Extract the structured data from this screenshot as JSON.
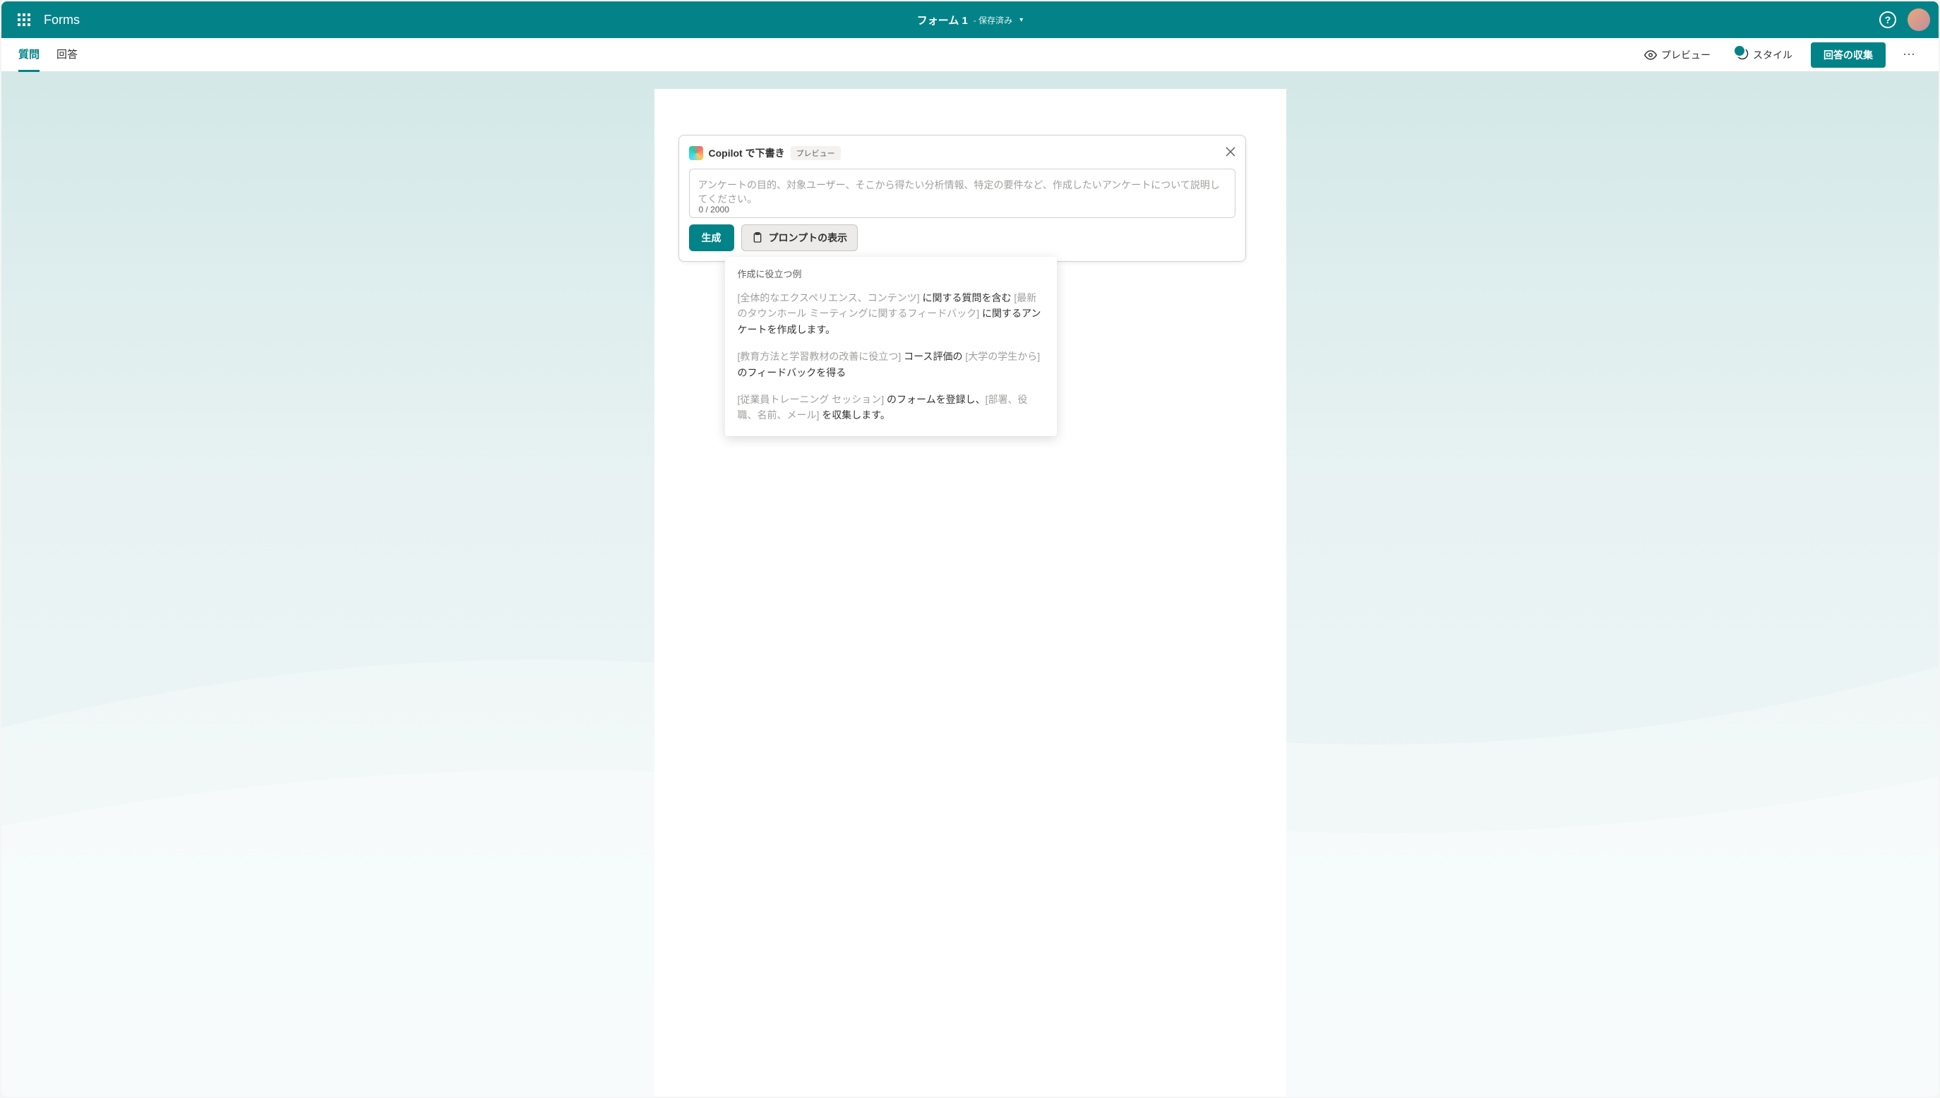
{
  "header": {
    "app_name": "Forms",
    "form_title": "フォーム 1",
    "save_status": "- 保存済み",
    "help_label": "?"
  },
  "toolbar": {
    "tabs": {
      "questions": "質問",
      "responses": "回答"
    },
    "preview": "プレビュー",
    "style": "スタイル",
    "collect": "回答の収集"
  },
  "copilot": {
    "title": "Copilot で下書き",
    "preview_badge": "プレビュー",
    "placeholder": "アンケートの目的、対象ユーザー、そこから得たい分析情報、特定の要件など、作成したいアンケートについて説明してください。",
    "char_count": "0 / 2000",
    "generate": "生成",
    "show_prompts": "プロンプトの表示"
  },
  "examples": {
    "heading": "作成に役立つ例",
    "items": [
      {
        "b1": "[全体的なエクスペリエンス、コンテンツ]",
        "t1": " に関する質問を含む ",
        "b2": "[最新のタウンホール ミーティングに関するフィードバック]",
        "t2": " に関するアンケートを作成します。"
      },
      {
        "b1": "[教育方法と学習教材の改善に役立つ]",
        "t1": " コース評価の ",
        "b2": "[大学の学生から]",
        "t2": " のフィードバックを得る"
      },
      {
        "b1": "[従業員トレーニング セッション]",
        "t1": " のフォームを登録し、",
        "b2": "[部署、役職、名前、メール]",
        "t2": " を収集します。"
      }
    ]
  }
}
